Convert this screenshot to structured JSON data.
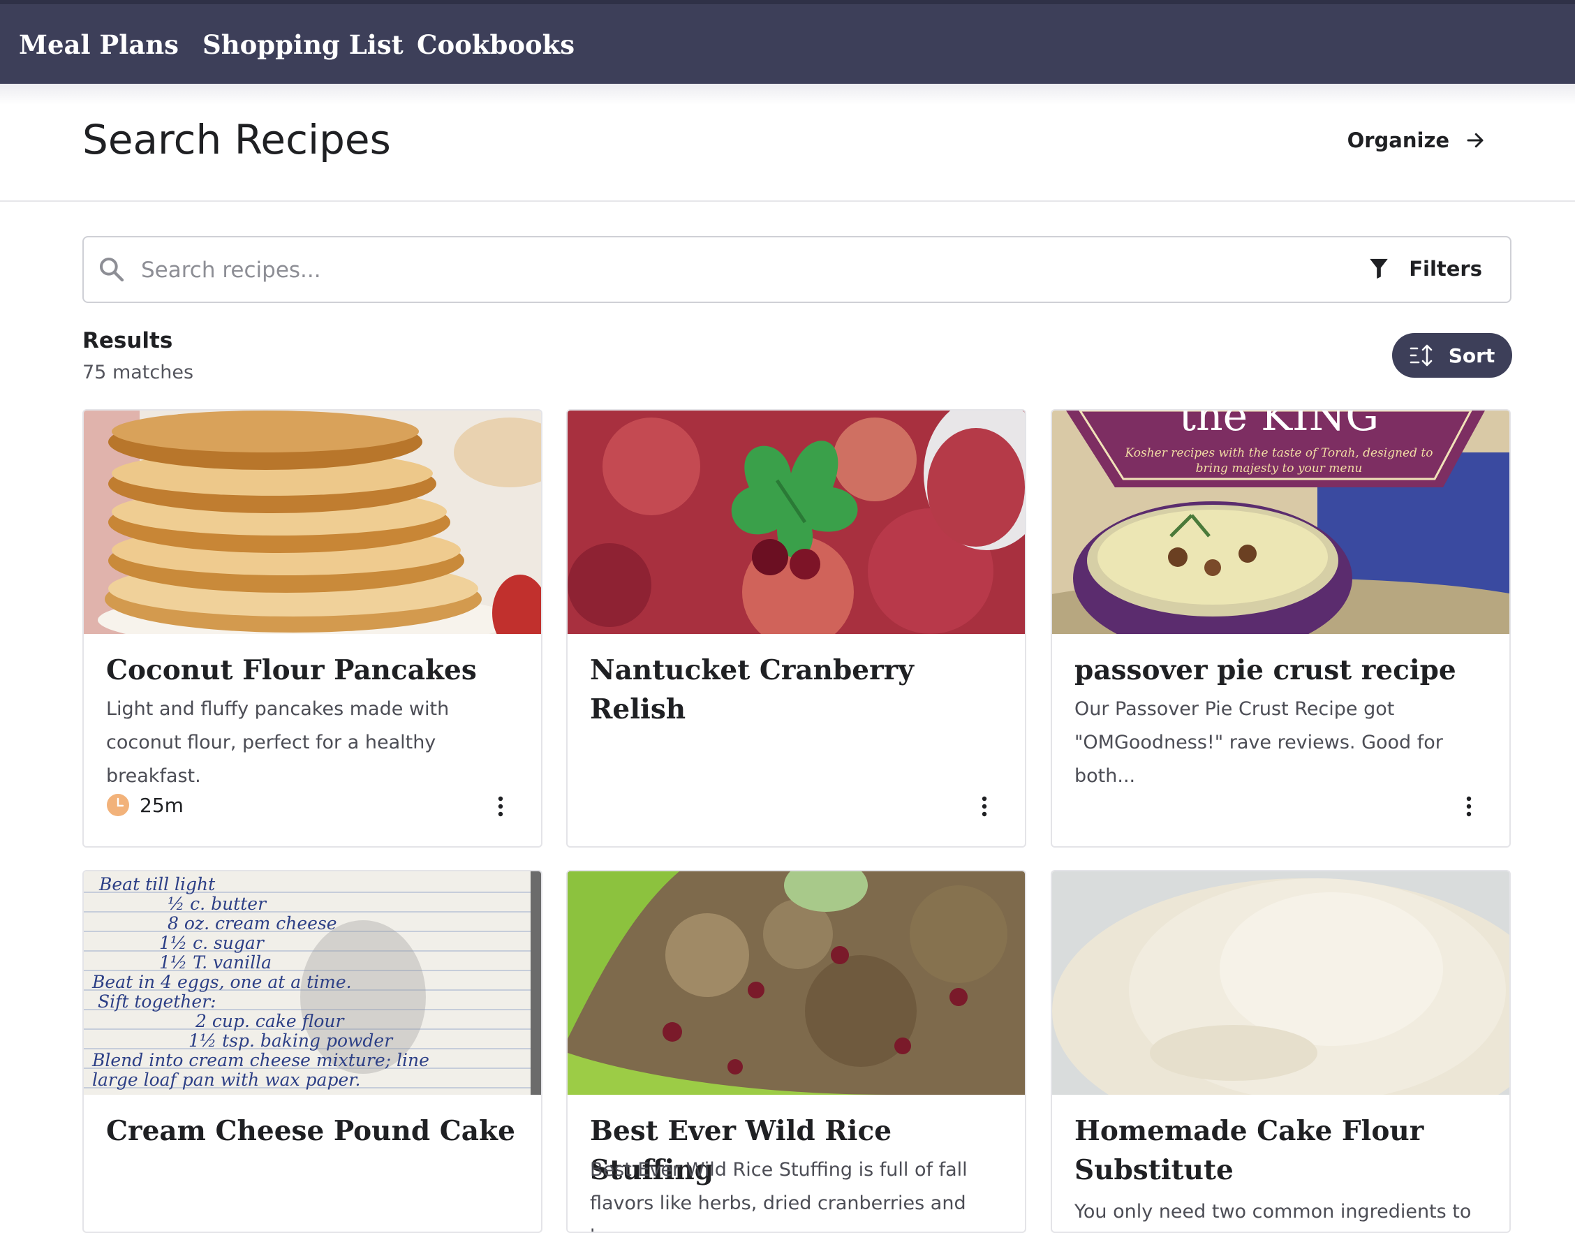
{
  "nav": {
    "items": [
      {
        "label": "Meal Plans"
      },
      {
        "label": "Shopping List"
      },
      {
        "label": "Cookbooks"
      }
    ]
  },
  "header": {
    "title": "Search Recipes",
    "organize_label": "Organize",
    "organize_icon": "arrow-right-icon"
  },
  "search": {
    "value": "",
    "placeholder": "Search recipes...",
    "icon": "search-icon",
    "filters_label": "Filters",
    "filters_icon": "funnel-icon"
  },
  "results": {
    "title": "Results",
    "count_text": "75 matches",
    "sort_label": "Sort",
    "sort_icon": "sort-icon"
  },
  "recipes": [
    {
      "title": "Coconut Flour Pancakes",
      "description": "Light and fluffy pancakes made with coconut flour, perfect for a healthy breakfast.",
      "time": "25m",
      "image": "pancakes-photo"
    },
    {
      "title": "Nantucket Cranberry Relish",
      "description": "",
      "time": "",
      "image": "cranberry-relish-photo"
    },
    {
      "title": "passover pie crust recipe",
      "description": "Our Passover Pie Crust Recipe got \"OMGoodness!\" rave reviews. Good for both...",
      "time": "",
      "image": "cookbook-cover-photo",
      "image_text": {
        "heading": "the KING",
        "tagline_1": "Kosher recipes with the taste of Torah, designed to",
        "tagline_2": "bring majesty to your menu"
      }
    },
    {
      "title": "Cream Cheese Pound Cake",
      "description": "",
      "time": "",
      "image": "handwritten-recipe-photo",
      "image_text": [
        "Beat till light",
        "½ c. butter",
        "8 oz. cream cheese",
        "1½ c. sugar",
        "1½ T. vanilla",
        "Beat in 4 eggs, one at a time.",
        "Sift together:",
        "2 cup. cake flour",
        "1½ tsp. baking powder",
        "Blend into cream cheese mixture; line",
        "large loaf pan with wax paper."
      ]
    },
    {
      "title": "Best Ever Wild Rice Stuffing",
      "description": "Best Ever Wild Rice Stuffing is full of fall flavors like herbs, dried cranberries and bacon.",
      "time": "",
      "image": "wild-rice-photo"
    },
    {
      "title": "Homemade Cake Flour Substitute",
      "description": "You only need two common ingredients to make homemade cake flour.",
      "time": "",
      "image": "flour-photo"
    }
  ],
  "colors": {
    "nav_bg": "#3d3f59",
    "sort_bg": "#3d3f59",
    "clock_accent": "#f2b27a"
  }
}
